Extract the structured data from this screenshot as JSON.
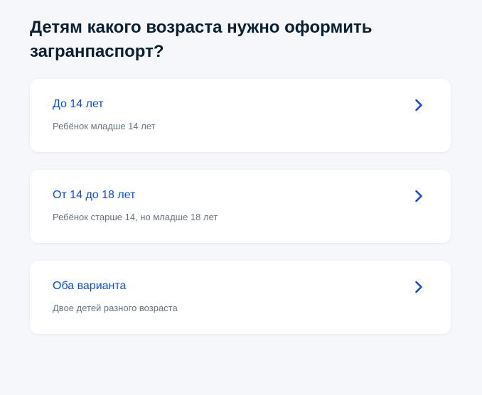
{
  "page": {
    "title": "Детям какого возраста нужно оформить загранпаспорт?"
  },
  "options": [
    {
      "title": "До 14 лет",
      "subtitle": "Ребёнок младше 14 лет",
      "icon": "chevron-right-icon"
    },
    {
      "title": "От 14 до 18 лет",
      "subtitle": "Ребёнок старше 14, но младше 18 лет",
      "icon": "chevron-right-icon"
    },
    {
      "title": "Оба варианта",
      "subtitle": "Двое детей разного возраста",
      "icon": "chevron-right-icon"
    }
  ],
  "colors": {
    "background": "#f5f7fb",
    "card": "#ffffff",
    "heading": "#0b1f33",
    "link": "#0d4cd3",
    "secondary_text": "#66727f"
  }
}
